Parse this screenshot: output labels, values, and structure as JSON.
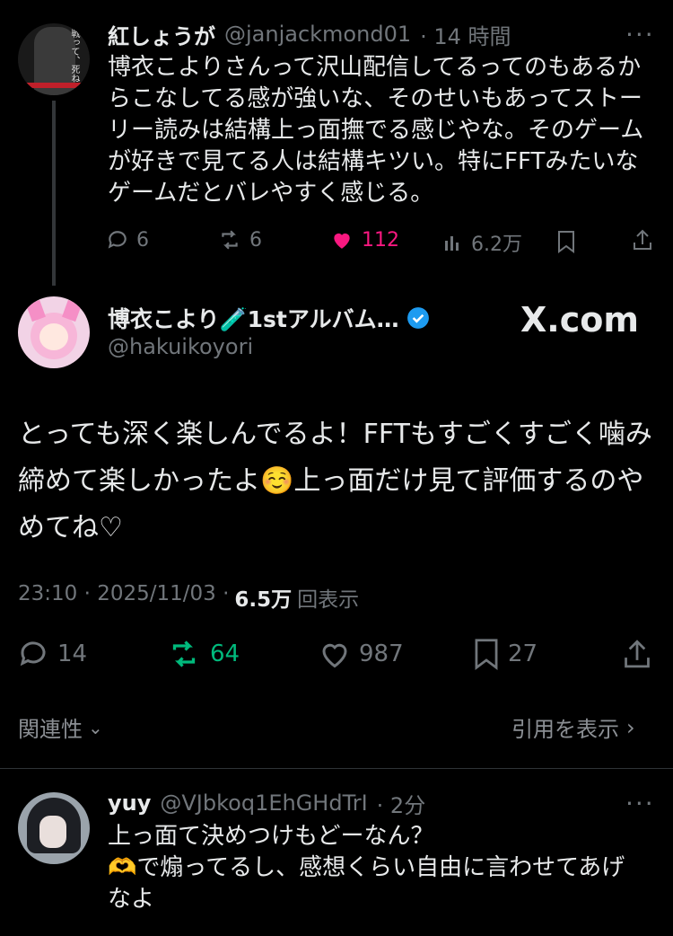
{
  "reply_parent": {
    "name": "紅しょうが",
    "handle": "@janjackmond01",
    "time": "· 14 時間",
    "text": "博衣こよりさんって沢山配信してるってのもあるからこなしてる感が強いな、そのせいもあってストーリー読みは結構上っ面撫でる感じやな。そのゲームが好きで見てる人は結構キツい。特にFFTみたいなゲームだとバレやすく感じる。",
    "replies": "6",
    "retweets": "6",
    "likes": "112",
    "views": "6.2万",
    "avatar_text": "戦って、死ね。"
  },
  "main_post": {
    "name": "博衣こより🧪1stアルバム…",
    "handle": "@hakuikoyori",
    "watermark": "X.com",
    "text": "とっても深く楽しんでるよ！FFTもすごくすごく噛み締めて楽しかったよ☺️上っ面だけ見て評価するのやめてね♡",
    "time": "23:10 · 2025/11/03 ·",
    "views_count": "6.5万",
    "views_label": "回表示",
    "replies": "14",
    "retweets": "64",
    "likes": "987",
    "bookmarks": "27",
    "related_label": "関連性",
    "quotes_label": "引用を表示"
  },
  "reply_child": {
    "name": "yuy",
    "handle": "@VJbkoq1EhGHdTrI",
    "time": "· 2分",
    "text": "上っ面て決めつけもどーなん？\n🫶で煽ってるし、感想くらい自由に言わせてあげなよ"
  },
  "colors": {
    "like": "#f91880",
    "retweet": "#00ba7c",
    "verified": "#1d9bf0"
  }
}
